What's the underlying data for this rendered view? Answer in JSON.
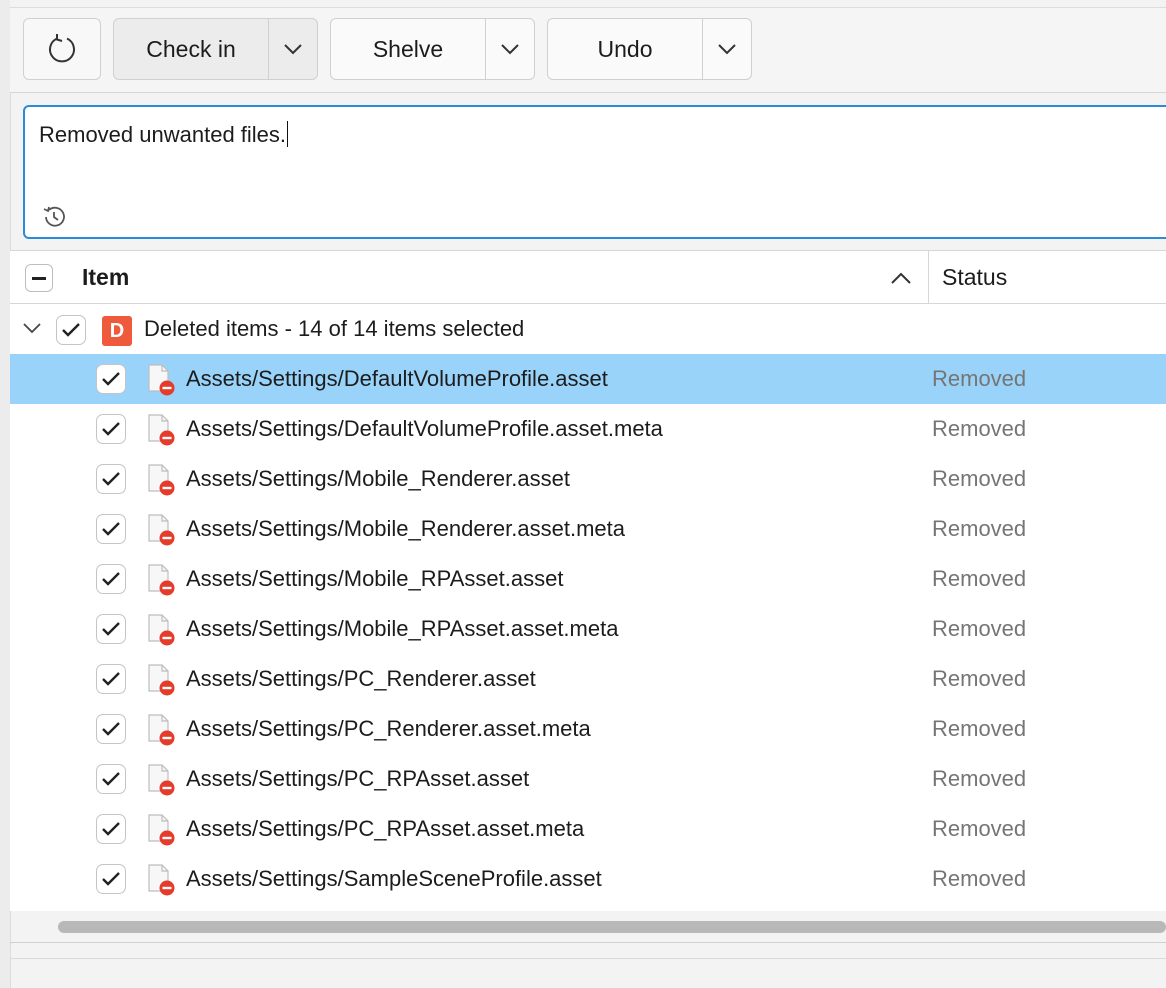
{
  "toolbar": {
    "refresh_icon": "refresh-icon",
    "checkin_label": "Check in",
    "shelve_label": "Shelve",
    "undo_label": "Undo"
  },
  "comment": {
    "value": "Removed unwanted files."
  },
  "table": {
    "columns": {
      "item": "Item",
      "status": "Status"
    },
    "group": {
      "badge": "D",
      "label": "Deleted items - 14 of 14 items selected"
    },
    "rows": [
      {
        "path": "Assets/Settings/DefaultVolumeProfile.asset",
        "status": "Removed",
        "selected": true
      },
      {
        "path": "Assets/Settings/DefaultVolumeProfile.asset.meta",
        "status": "Removed"
      },
      {
        "path": "Assets/Settings/Mobile_Renderer.asset",
        "status": "Removed"
      },
      {
        "path": "Assets/Settings/Mobile_Renderer.asset.meta",
        "status": "Removed"
      },
      {
        "path": "Assets/Settings/Mobile_RPAsset.asset",
        "status": "Removed"
      },
      {
        "path": "Assets/Settings/Mobile_RPAsset.asset.meta",
        "status": "Removed"
      },
      {
        "path": "Assets/Settings/PC_Renderer.asset",
        "status": "Removed"
      },
      {
        "path": "Assets/Settings/PC_Renderer.asset.meta",
        "status": "Removed"
      },
      {
        "path": "Assets/Settings/PC_RPAsset.asset",
        "status": "Removed"
      },
      {
        "path": "Assets/Settings/PC_RPAsset.asset.meta",
        "status": "Removed"
      },
      {
        "path": "Assets/Settings/SampleSceneProfile.asset",
        "status": "Removed"
      }
    ]
  },
  "colors": {
    "accent": "#2b8bd6",
    "selected_row": "#99d3f9",
    "deleted_badge": "#ef5a3c",
    "removed_icon": "#e53b2b",
    "status_text": "#757575"
  }
}
